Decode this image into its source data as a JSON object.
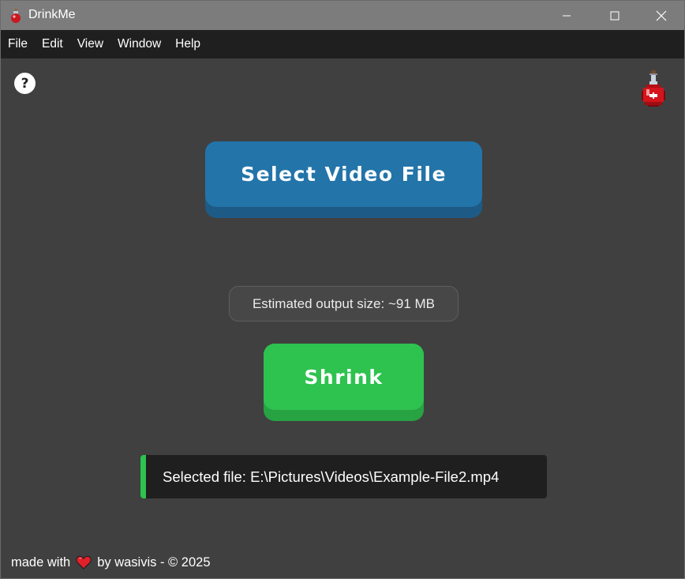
{
  "window": {
    "title": "DrinkMe",
    "controls": {
      "minimize_icon": "minimize-icon",
      "maximize_icon": "maximize-icon",
      "close_icon": "close-icon"
    }
  },
  "menu": {
    "items": [
      {
        "label": "File"
      },
      {
        "label": "Edit"
      },
      {
        "label": "View"
      },
      {
        "label": "Window"
      },
      {
        "label": "Help"
      }
    ]
  },
  "toolbar": {
    "help_label": "?",
    "logo_icon": "potion-bottle-icon"
  },
  "main": {
    "select_button_label": "Select Video File",
    "estimate_text": "Estimated output size: ~91 MB",
    "shrink_button_label": "Shrink",
    "selected_file_text": "Selected file: E:\\Pictures\\Videos\\Example-File2.mp4"
  },
  "footer": {
    "made_with": "made with",
    "heart_icon": "heart-icon",
    "by_text": "by wasivis - © 2025"
  },
  "colors": {
    "background": "#404040",
    "select_button": "#2374a9",
    "shrink_button": "#2ec24f",
    "accent_bar": "#2ec24f",
    "heart": "#e0202a"
  }
}
